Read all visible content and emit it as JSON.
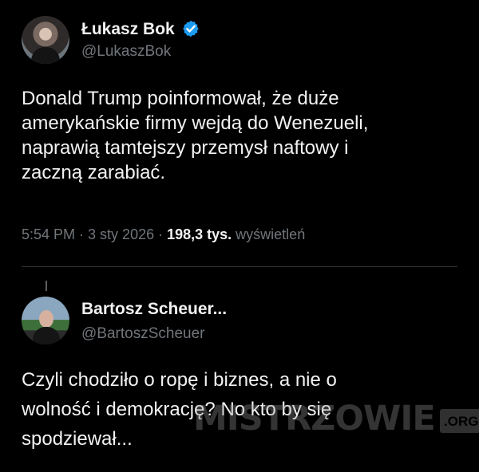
{
  "tweet": {
    "author": {
      "name": "Łukasz Bok",
      "handle": "@LukaszBok",
      "verified_icon": "verified-badge-icon",
      "avatar_icon": "profile-avatar"
    },
    "text": "Donald Trump poinformował, że duże\namerykańskie firmy wejdą do Wenezueli,\nnaprawią tamtejszy przemysł naftowy i\nzaczną zarabiać.",
    "meta": {
      "time": "5:54 PM",
      "separator_1": " · ",
      "date": "3 sty 2026",
      "separator_2": " · ",
      "views_count": "198,3 tys.",
      "views_label": " wyświetleń"
    }
  },
  "reply": {
    "author": {
      "name": "Bartosz Scheuer...",
      "handle": "@BartoszScheuer",
      "avatar_icon": "profile-avatar"
    },
    "text": "Czyli chodziło o ropę i biznes, a nie o\nwolność i demokrację? No kto by się\nspodziewał..."
  },
  "watermark": {
    "main": "MISTRZOWIE",
    "badge": ".ORG"
  },
  "colors": {
    "background": "#000000",
    "primary_text": "#f2f2f2",
    "secondary_text": "#71767b",
    "divider": "#2f3336",
    "verified": "#1d9bf0"
  }
}
